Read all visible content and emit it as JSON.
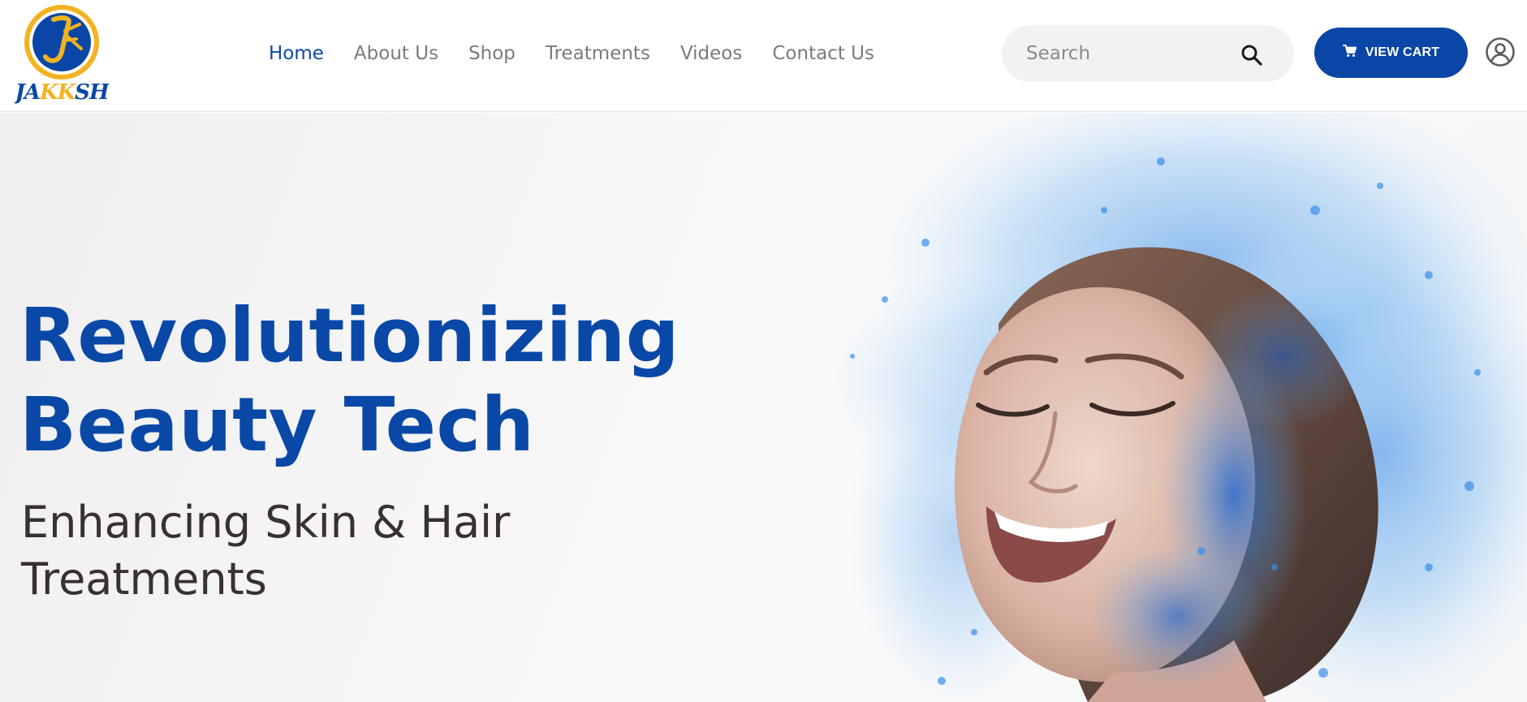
{
  "brand": {
    "logo_text": "JAKKSH",
    "colors": {
      "primary_blue": "#0a46a5",
      "gold": "#f3b21f",
      "nav_text": "#7b7b7b",
      "heading_blue": "#0a48a8"
    }
  },
  "nav": {
    "items": [
      {
        "label": "Home",
        "active": true
      },
      {
        "label": "About Us",
        "active": false
      },
      {
        "label": "Shop",
        "active": false
      },
      {
        "label": "Treatments",
        "active": false
      },
      {
        "label": "Videos",
        "active": false
      },
      {
        "label": "Contact Us",
        "active": false
      }
    ]
  },
  "search": {
    "placeholder": "Search",
    "icon": "search-icon"
  },
  "cart": {
    "label": "VIEW CART",
    "icon": "cart-icon"
  },
  "account": {
    "icon": "user-icon"
  },
  "hero": {
    "headline_line1": "Revolutionizing",
    "headline_line2": "Beauty Tech",
    "subheading_line1": "Enhancing Skin & Hair",
    "subheading_line2": "Treatments"
  }
}
